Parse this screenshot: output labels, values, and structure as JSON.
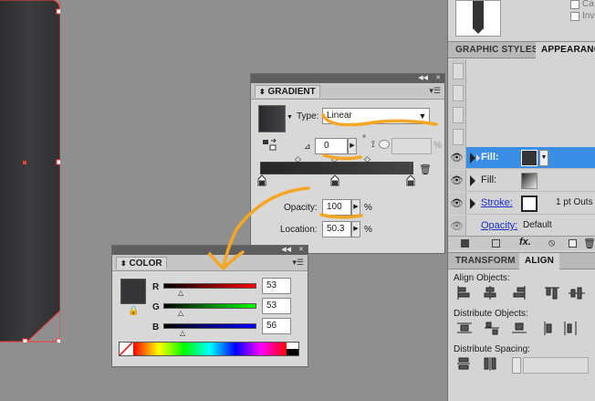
{
  "dock": {
    "top_checks": [
      "Ca",
      "Inv"
    ],
    "tabs_styles": [
      "GRAPHIC STYLES",
      "APPEARANCE"
    ],
    "appearance_rows": [
      {
        "label": "Fill:",
        "detail": ""
      },
      {
        "label": "Fill:",
        "detail": ""
      },
      {
        "label": "Stroke:",
        "detail": "1 pt  Outs"
      },
      {
        "label": "Opacity:",
        "detail": "Default"
      }
    ],
    "tabs_transform": [
      "TRANSFORM",
      "ALIGN"
    ],
    "align_objects_label": "Align Objects:",
    "distribute_objects_label": "Distribute Objects:",
    "distribute_spacing_label": "Distribute Spacing:"
  },
  "gradient": {
    "title": "GRADIENT",
    "type_label": "Type:",
    "type_value": "Linear",
    "angle_value": "0",
    "degree": "°",
    "aspect_unit": "%",
    "opacity_label": "Opacity:",
    "opacity_value": "100",
    "opacity_unit": "%",
    "location_label": "Location:",
    "location_value": "50.3",
    "location_unit": "%"
  },
  "color": {
    "title": "COLOR",
    "channels": [
      {
        "name": "R",
        "value": "53"
      },
      {
        "name": "G",
        "value": "53"
      },
      {
        "name": "B",
        "value": "56"
      }
    ],
    "swatch": "#353538"
  },
  "colors": {
    "annotation": "#f5a623",
    "selection": "#ff3b3b",
    "fill_highlight": "#3a8ee6"
  }
}
